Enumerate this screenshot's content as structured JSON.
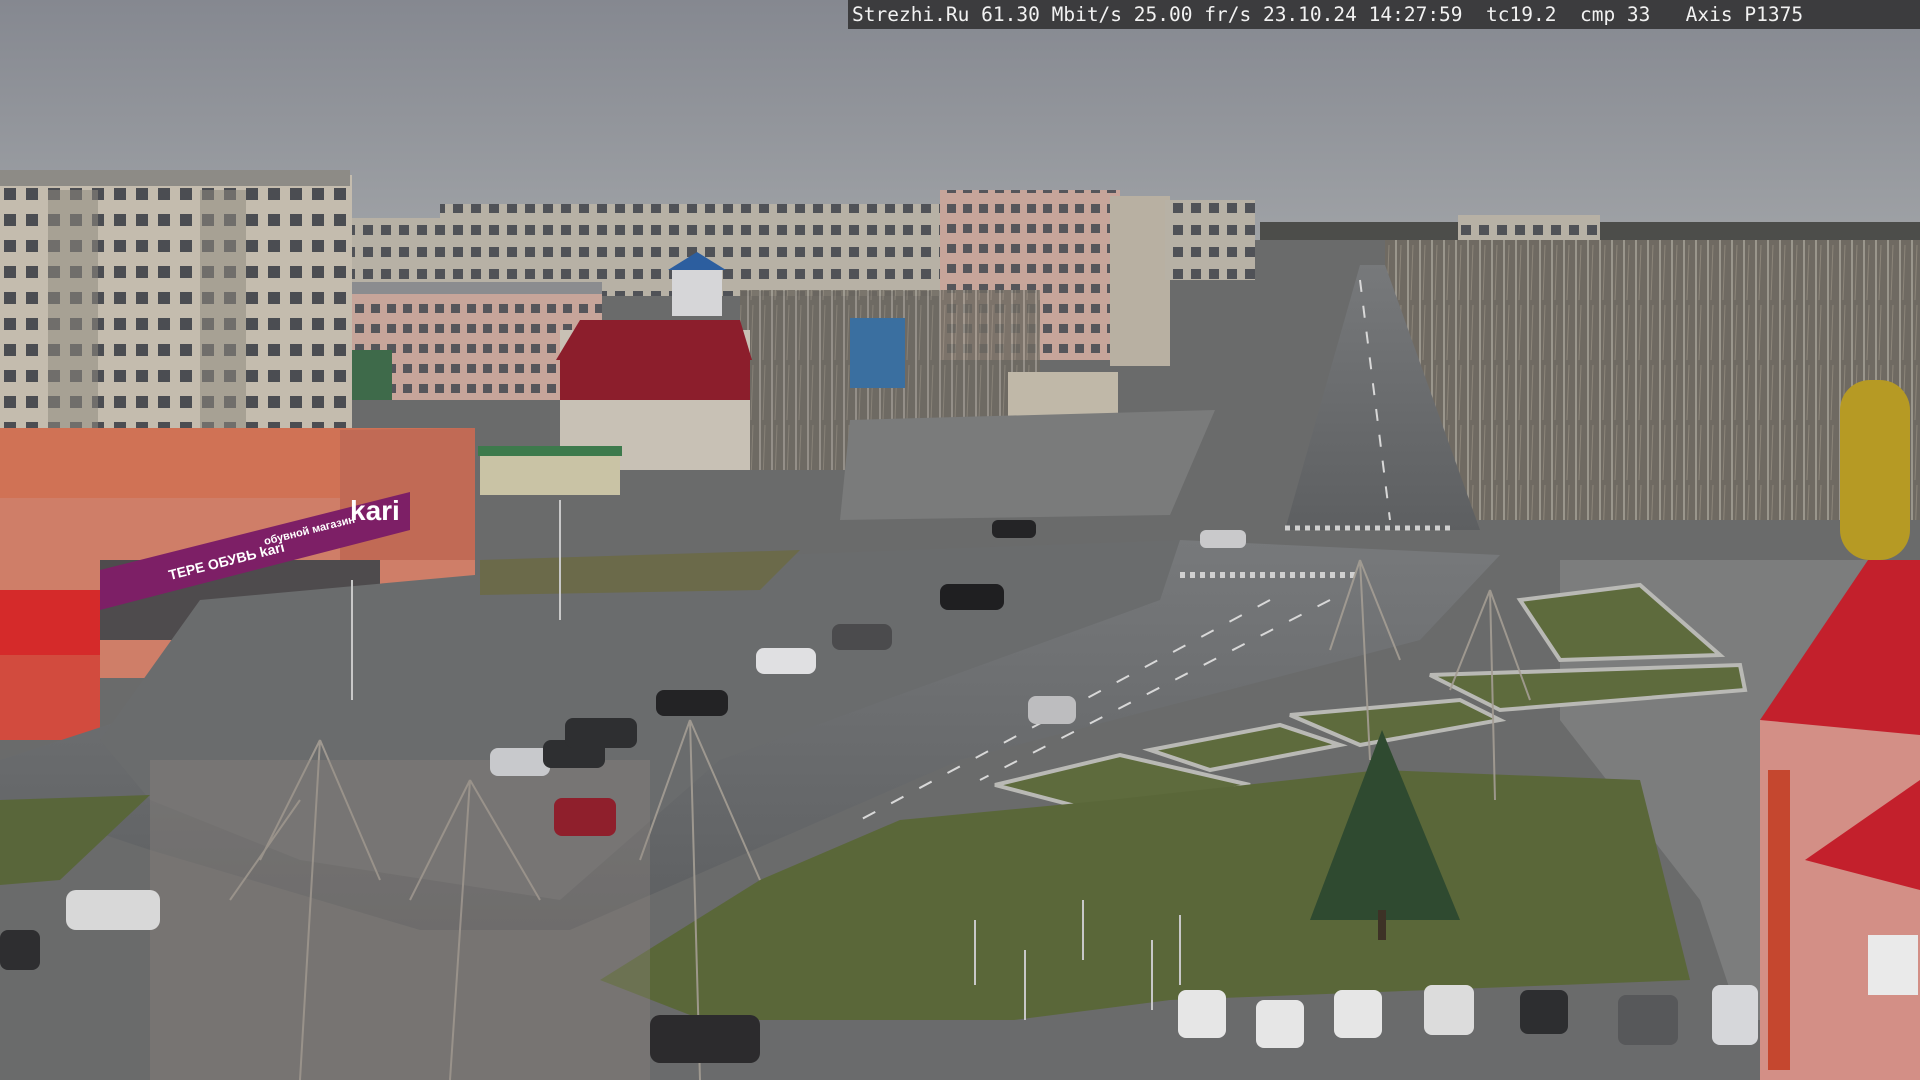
{
  "overlay": {
    "site": "Strezhi.Ru",
    "bitrate": "61.30 Mbit/s",
    "framerate": "25.00 fr/s",
    "timestamp": "23.10.24 14:27:59",
    "tc": "tc19.2",
    "cmp": "cmp 33",
    "camera": "Axis P1375"
  },
  "signs": {
    "store_logo": "kari",
    "store_banner": "ТЕРЕ ОБУВЬ kari",
    "store_banner_2": "обувной магазин"
  },
  "colors": {
    "sky": "#8e9196",
    "asphalt": "#6c6e70",
    "grass": "#5d6b3a",
    "brick_building": "#c9c2b4",
    "kari_banner": "#7d1f66",
    "red_roof": "#b8222f",
    "overlay_bg": "#3c3c3e"
  }
}
